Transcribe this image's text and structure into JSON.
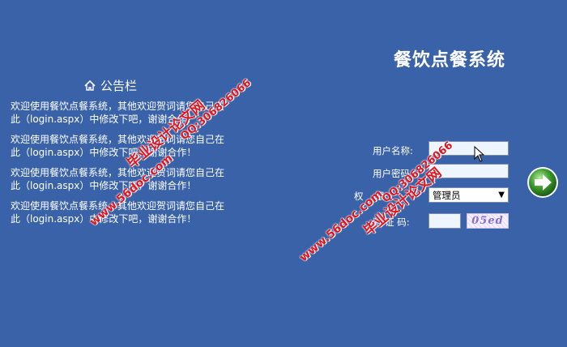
{
  "app": {
    "title": "餐饮点餐系统"
  },
  "notice": {
    "header": "公告栏",
    "items": [
      "欢迎使用餐饮点餐系统，其他欢迎贺词请您自己在此（login.aspx）中修改下吧，谢谢合作！",
      "欢迎使用餐饮点餐系统，其他欢迎贺词请您自己在此（login.aspx）中修改下吧，谢谢合作！",
      "欢迎使用餐饮点餐系统，其他欢迎贺词请您自己在此（login.aspx）中修改下吧，谢谢合作！",
      "欢迎使用餐饮点餐系统，其他欢迎贺词请您自己在此（login.aspx）中修改下吧，谢谢合作！"
    ]
  },
  "login": {
    "username_label": "用户名称:",
    "username_value": "",
    "password_label": "用户密码:",
    "password_value": "",
    "role_label": "权    限:",
    "role_value": "管理员",
    "captcha_label": "验 证 码:",
    "captcha_value": "",
    "captcha_image_text": "05ed"
  },
  "watermarks": {
    "site": "www.56doc.com",
    "brand": "毕业设计论文网",
    "qq": "QQ:306826066"
  },
  "colors": {
    "background": "#3a62a8",
    "watermark_red": "#e0141e",
    "go_button_green": "#3c9a2c"
  },
  "icons": {
    "home": "home-icon",
    "go": "arrow-right-circle-icon",
    "cursor": "mouse-pointer-icon"
  }
}
